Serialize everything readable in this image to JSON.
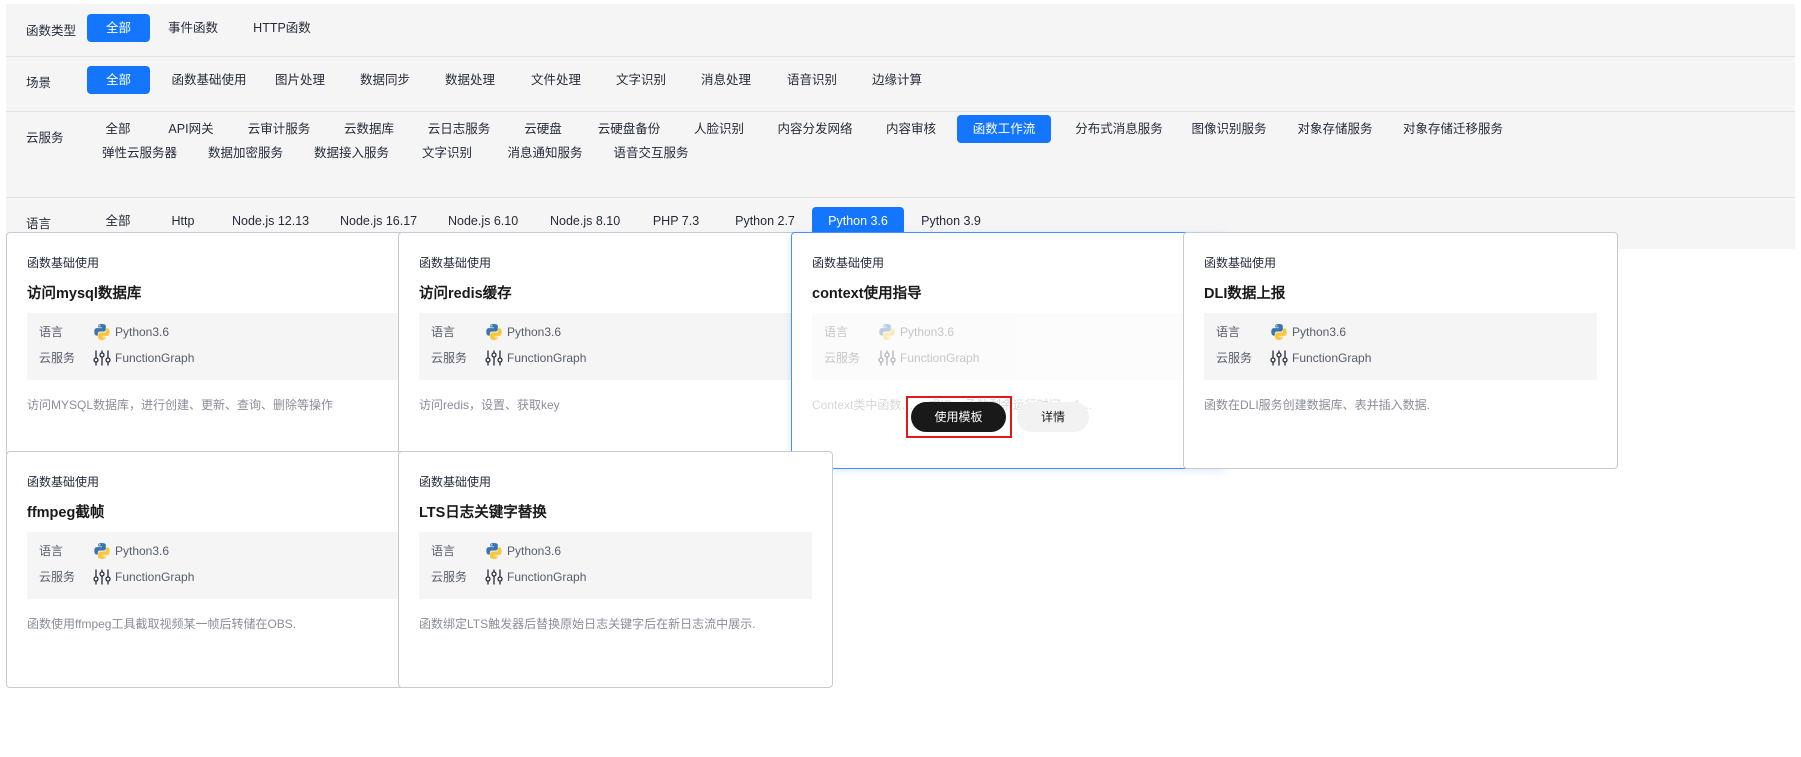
{
  "filters": {
    "function_type": {
      "label": "函数类型",
      "options": [
        "全部",
        "事件函数",
        "HTTP函数"
      ],
      "selected": "全部"
    },
    "scenario": {
      "label": "场景",
      "options": [
        "全部",
        "函数基础使用",
        "图片处理",
        "数据同步",
        "数据处理",
        "文件处理",
        "文字识别",
        "消息处理",
        "语音识别",
        "边缘计算"
      ],
      "selected": "全部"
    },
    "cloud_service": {
      "label": "云服务",
      "options": [
        "全部",
        "API网关",
        "云审计服务",
        "云数据库",
        "云日志服务",
        "云硬盘",
        "云硬盘备份",
        "人脸识别",
        "内容分发网络",
        "内容审核",
        "函数工作流",
        "分布式消息服务",
        "图像识别服务",
        "对象存储服务",
        "对象存储迁移服务",
        "弹性云服务器",
        "数据加密服务",
        "数据接入服务",
        "文字识别",
        "消息通知服务",
        "语音交互服务"
      ],
      "selected": "函数工作流"
    },
    "language": {
      "label": "语言",
      "options": [
        "全部",
        "Http",
        "Node.js 12.13",
        "Node.js 16.17",
        "Node.js 6.10",
        "Node.js 8.10",
        "PHP 7.3",
        "Python 2.7",
        "Python 3.6",
        "Python 3.9"
      ],
      "selected": "Python 3.6"
    }
  },
  "cards": [
    {
      "category": "函数基础使用",
      "title": "访问mysql数据库",
      "language_label": "语言",
      "language": "Python3.6",
      "service_label": "云服务",
      "service": "FunctionGraph",
      "description": "访问MYSQL数据库，进行创建、更新、查询、删除等操作"
    },
    {
      "category": "函数基础使用",
      "title": "访问redis缓存",
      "language_label": "语言",
      "language": "Python3.6",
      "service_label": "云服务",
      "service": "FunctionGraph",
      "description": "访问redis，设置、获取key"
    },
    {
      "category": "函数基础使用",
      "title": "context使用指导",
      "language_label": "语言",
      "language": "Python3.6",
      "service_label": "云服务",
      "service": "FunctionGraph",
      "description": "Context类中函数… …求ID、函数剩余运行时间、A…",
      "hovered": true,
      "use_button": "使用模板",
      "detail_button": "详情"
    },
    {
      "category": "函数基础使用",
      "title": "DLI数据上报",
      "language_label": "语言",
      "language": "Python3.6",
      "service_label": "云服务",
      "service": "FunctionGraph",
      "description": "函数在DLI服务创建数据库、表并插入数据."
    },
    {
      "category": "函数基础使用",
      "title": "ffmpeg截帧",
      "language_label": "语言",
      "language": "Python3.6",
      "service_label": "云服务",
      "service": "FunctionGraph",
      "description": "函数使用ffmpeg工具截取视频某一帧后转储在OBS."
    },
    {
      "category": "函数基础使用",
      "title": "LTS日志关键字替换",
      "language_label": "语言",
      "language": "Python3.6",
      "service_label": "云服务",
      "service": "FunctionGraph",
      "description": "函数绑定LTS触发器后替换原始日志关键字后在新日志流中展示."
    }
  ],
  "icons": {
    "language": "python-icon",
    "service": "functiongraph-icon"
  },
  "colors": {
    "accent": "#1476ff",
    "panel_bg": "#f5f5f5",
    "highlight": "#e0191f"
  }
}
